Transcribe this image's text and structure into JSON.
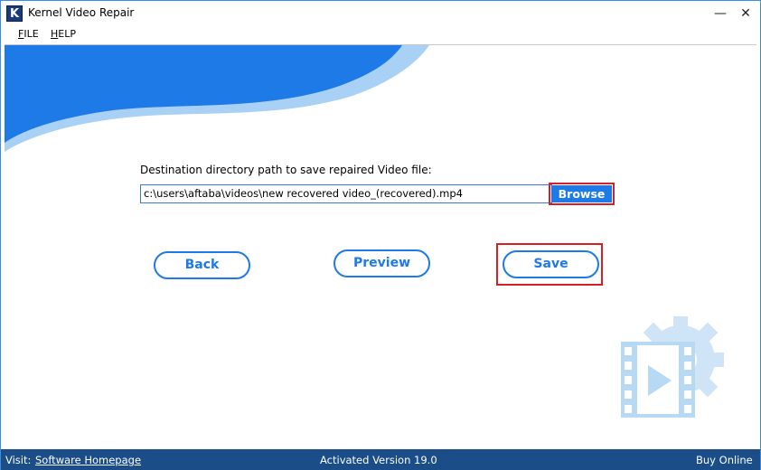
{
  "window": {
    "title": "Kernel Video Repair",
    "icon_letter": "K",
    "minimize_glyph": "—",
    "close_glyph": "✕"
  },
  "menu": {
    "file": {
      "first": "F",
      "rest": "ILE"
    },
    "help": {
      "first": "H",
      "rest": "ELP"
    }
  },
  "main": {
    "destination_label": "Destination directory path to save repaired Video file:",
    "destination_path": "c:\\users\\aftaba\\videos\\new recovered video_(recovered).mp4",
    "browse_label": "Browse",
    "back_label": "Back",
    "preview_label": "Preview",
    "save_label": "Save"
  },
  "status": {
    "visit_label": "Visit:",
    "homepage_link": "Software Homepage",
    "version": "Activated Version 19.0",
    "buy_online": "Buy Online"
  },
  "colors": {
    "accent_blue": "#1e7ae6",
    "highlight_red": "#d81f26",
    "statusbar_bg": "#1b4d89",
    "wave_blue": "#1e7ae6",
    "wave_light": "#a9d1f5",
    "logo_light": "#cfe4f7"
  },
  "icons": [
    "app-logo-icon",
    "minimize-icon",
    "close-icon",
    "video-gear-logo-icon"
  ]
}
